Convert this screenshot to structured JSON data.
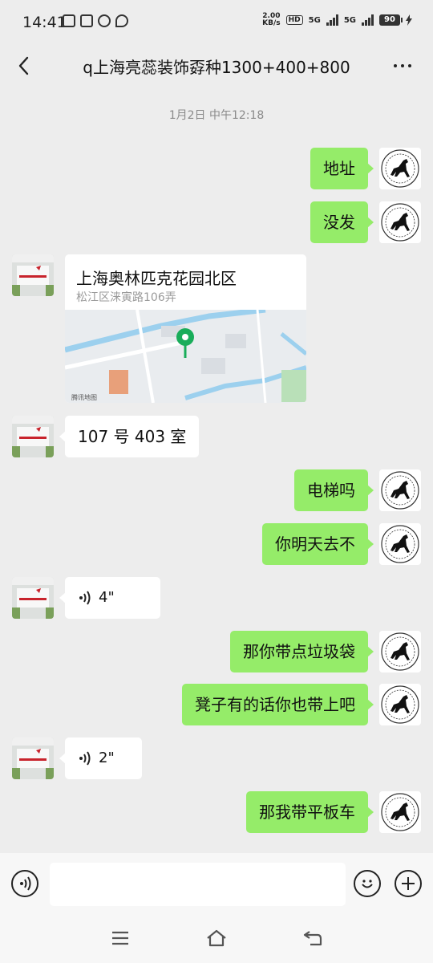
{
  "status": {
    "time": "14:41",
    "netspeed_value": "2.00",
    "netspeed_unit": "KB/s",
    "hd_badge": "HD",
    "signal_1": "5G",
    "signal_2": "5G",
    "battery": "90"
  },
  "header": {
    "title": "q上海亮蕊装饰孬种1300+400+800",
    "back_icon": "chevron-left",
    "more_icon": "ellipsis"
  },
  "chat": {
    "timestamp": "1月2日 中午12:18",
    "messages": [
      {
        "from": "self",
        "type": "text",
        "text": "地址"
      },
      {
        "from": "self",
        "type": "text",
        "text": "没发"
      },
      {
        "from": "peer",
        "type": "location",
        "name": "上海奥林匹克花园北区",
        "address": "松江区涞寅路106弄",
        "map_credit": "腾讯地图"
      },
      {
        "from": "peer",
        "type": "text",
        "text": "107 号 403 室"
      },
      {
        "from": "self",
        "type": "text",
        "text": "电梯吗"
      },
      {
        "from": "self",
        "type": "text",
        "text": "你明天去不"
      },
      {
        "from": "peer",
        "type": "voice",
        "duration": "4\""
      },
      {
        "from": "self",
        "type": "text",
        "text": "那你带点垃圾袋"
      },
      {
        "from": "self",
        "type": "text",
        "text": "凳子有的话你也带上吧"
      },
      {
        "from": "peer",
        "type": "voice",
        "duration": "2\""
      },
      {
        "from": "self",
        "type": "text",
        "text": "那我带平板车"
      }
    ]
  },
  "input_bar": {
    "voice_icon": "voice-input",
    "emoji_icon": "smiley",
    "plus_icon": "plus",
    "placeholder": ""
  },
  "colors": {
    "outgoing_bubble": "#95ec69",
    "incoming_bubble": "#ffffff",
    "chat_background": "#ededed",
    "map_pin": "#19ad5a"
  }
}
